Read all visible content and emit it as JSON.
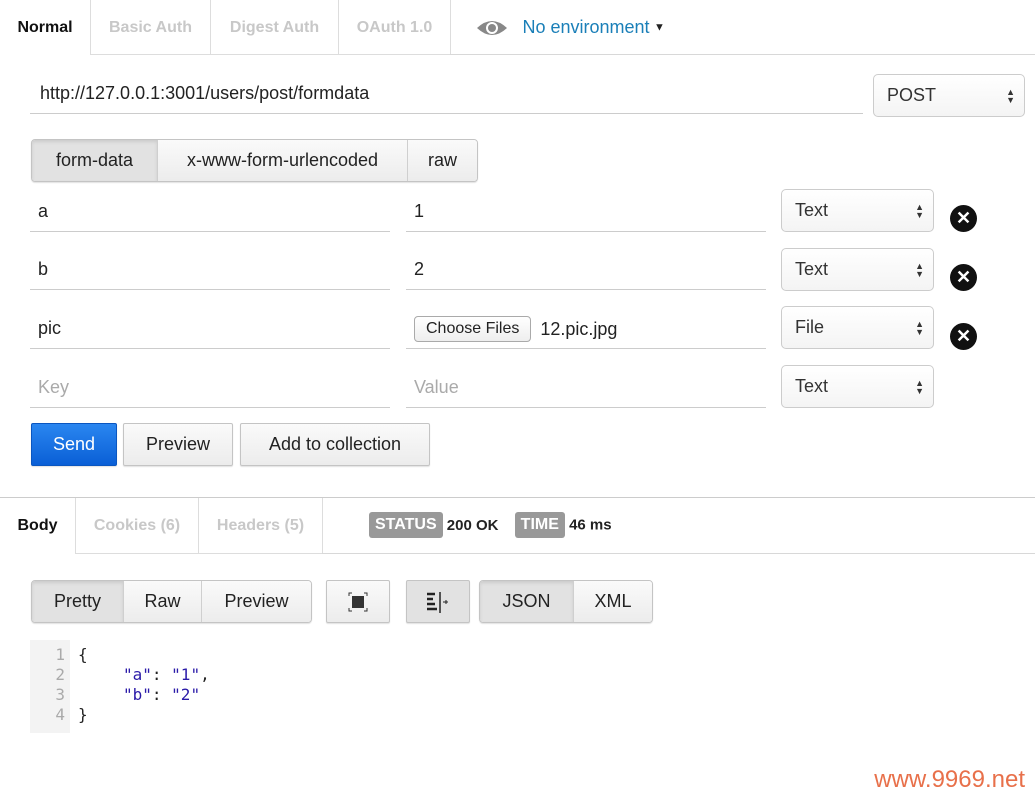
{
  "auth_tabs": [
    {
      "label": "Normal",
      "active": true
    },
    {
      "label": "Basic Auth"
    },
    {
      "label": "Digest Auth"
    },
    {
      "label": "OAuth 1.0"
    }
  ],
  "environment": {
    "icon": "eye-icon",
    "label": "No environment",
    "color": "#1a7fb8"
  },
  "request": {
    "url": "http://127.0.0.1:3001/users/post/formdata",
    "method": "POST"
  },
  "body_modes": [
    {
      "label": "form-data",
      "active": true
    },
    {
      "label": "x-www-form-urlencoded"
    },
    {
      "label": "raw"
    }
  ],
  "form_rows": [
    {
      "key": "a",
      "value": "1",
      "type": "Text"
    },
    {
      "key": "b",
      "value": "2",
      "type": "Text"
    },
    {
      "key": "pic",
      "file_button": "Choose Files",
      "value": "12.pic.jpg",
      "type": "File"
    }
  ],
  "new_row": {
    "key_placeholder": "Key",
    "value_placeholder": "Value",
    "type": "Text"
  },
  "actions": {
    "send": "Send",
    "preview": "Preview",
    "add_to_collection": "Add to collection",
    "send_color": "#0a5fd6"
  },
  "response_tabs": [
    {
      "label": "Body",
      "active": true
    },
    {
      "label": "Cookies (6)"
    },
    {
      "label": "Headers (5)"
    }
  ],
  "status": {
    "status_label": "STATUS",
    "status_value": "200 OK",
    "time_label": "TIME",
    "time_value": "46 ms"
  },
  "view_modes": [
    {
      "label": "Pretty",
      "active": true
    },
    {
      "label": "Raw"
    },
    {
      "label": "Preview"
    }
  ],
  "format_modes": [
    {
      "label": "JSON",
      "active": true
    },
    {
      "label": "XML"
    }
  ],
  "code_lines": [
    {
      "n": "1",
      "text": "{"
    },
    {
      "n": "2",
      "key": "\"a\"",
      "val": "\"1\"",
      "trail": ","
    },
    {
      "n": "3",
      "key": "\"b\"",
      "val": "\"2\"",
      "trail": ""
    },
    {
      "n": "4",
      "text": "}"
    }
  ],
  "watermark": "www.9969.net"
}
